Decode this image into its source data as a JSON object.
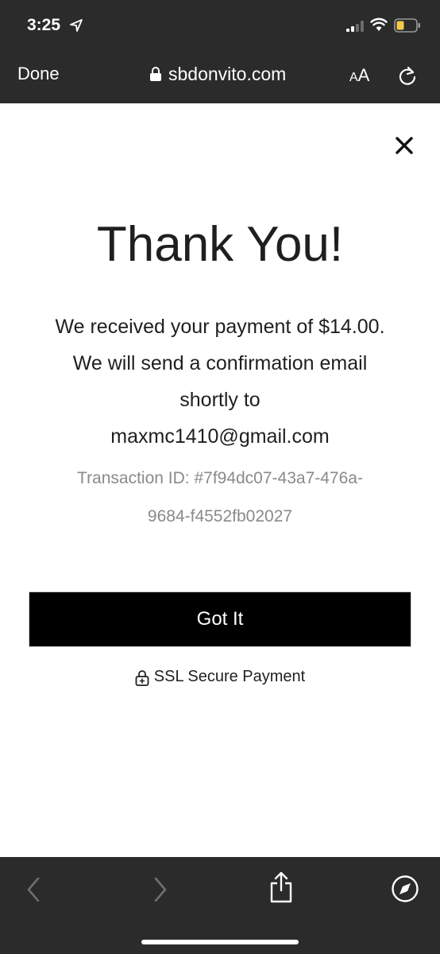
{
  "status_bar": {
    "time": "3:25",
    "icons": [
      "location-arrow-icon",
      "signal-icon",
      "wifi-icon",
      "battery-icon"
    ],
    "battery_color": "#f2c94c"
  },
  "browser": {
    "done_label": "Done",
    "url": "sbdonvito.com",
    "aa_small": "A",
    "aa_big": "A",
    "icons": [
      "lock-icon",
      "reload-icon"
    ]
  },
  "content": {
    "title": "Thank You!",
    "message_line1": "We received your payment of $14.00.",
    "message_line2": "We will send a confirmation email",
    "message_line3": "shortly to",
    "email": "maxmc1410@gmail.com",
    "transaction_line1": "Transaction ID: #7f94dc07-43a7-476a-",
    "transaction_line2": "9684-f4552fb02027",
    "button_label": "Got It",
    "ssl_label": "SSL Secure Payment"
  },
  "toolbar": {
    "icons": [
      "back-icon",
      "forward-icon",
      "share-icon",
      "compass-icon"
    ]
  },
  "colors": {
    "bar_background": "#2b2b2b",
    "button_background": "#000000",
    "text_primary": "#1f1f1f",
    "text_secondary": "#8a8a8a"
  }
}
